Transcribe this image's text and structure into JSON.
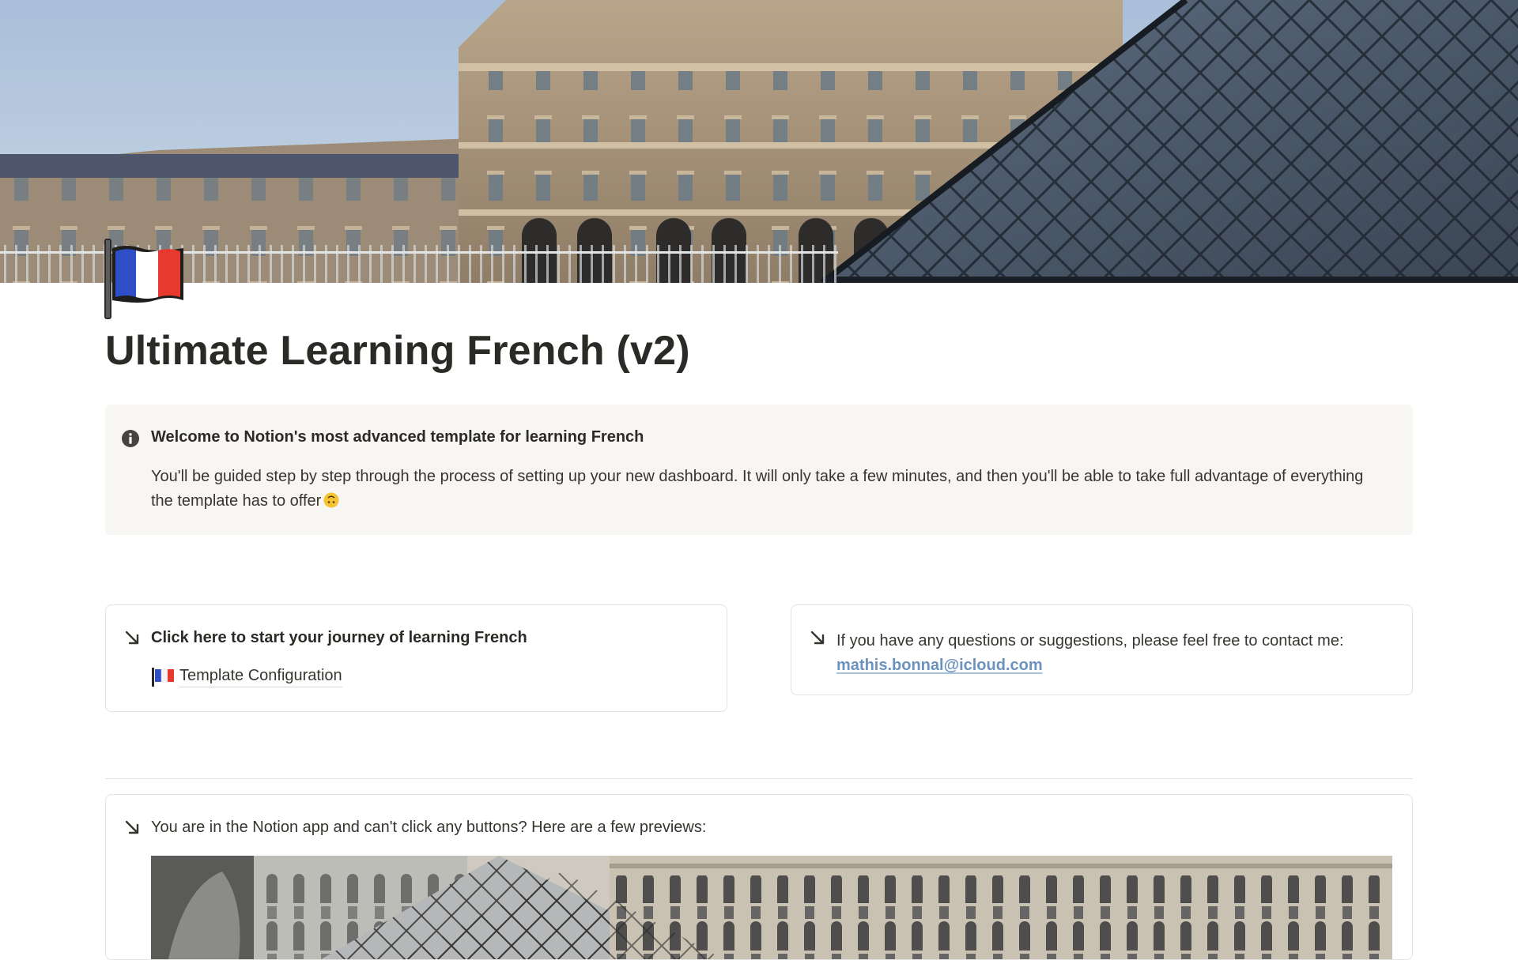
{
  "page": {
    "title": "Ultimate Learning French (v2)",
    "icon": "french-flag-icon"
  },
  "callout": {
    "icon": "info-icon",
    "heading": "Welcome to Notion's most advanced template for learning French",
    "body": "You'll be guided step by step through the process of setting up your new dashboard. It will only take a few minutes, and then you'll be able to take full advantage of everything the template has to offer",
    "emoji": "upside-down-face-emoji"
  },
  "start_card": {
    "icon": "arrow-down-right-icon",
    "heading": "Click here to start your journey of learning French",
    "link_label": "Template Configuration",
    "link_icon": "french-flag-icon"
  },
  "contact_card": {
    "icon": "arrow-down-right-icon",
    "text": "If you have any questions or suggestions, please feel free to contact me:",
    "email": "mathis.bonnal@icloud.com"
  },
  "preview_card": {
    "icon": "arrow-down-right-icon",
    "text": "You are in the Notion app and can't click any buttons? Here are a few previews:"
  },
  "colors": {
    "text": "#37352f",
    "callout_bg": "#f7f6f3",
    "border": "#e3e2e0",
    "link": "#6b93bd",
    "flag_blue": "#2f4fc8",
    "flag_red": "#e8392f"
  }
}
